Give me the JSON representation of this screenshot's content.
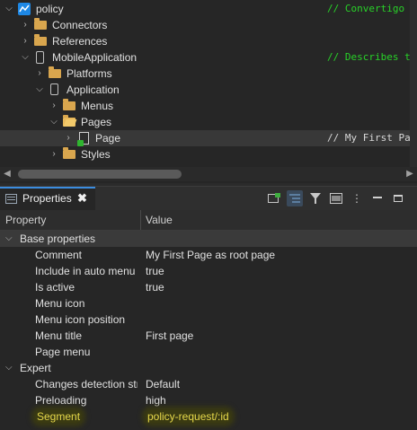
{
  "tree": {
    "rows": [
      {
        "label": "policy",
        "comment": "// Convertigo Mo"
      },
      {
        "label": "Connectors"
      },
      {
        "label": "References"
      },
      {
        "label": "MobileApplication",
        "comment": "// Describes the m"
      },
      {
        "label": "Platforms"
      },
      {
        "label": "Application"
      },
      {
        "label": "Menus"
      },
      {
        "label": "Pages"
      },
      {
        "label": "Page",
        "comment": "// My First Page a"
      },
      {
        "label": "Styles"
      }
    ]
  },
  "properties_view": {
    "tab_title": "Properties",
    "close_glyph": "✖",
    "columns": {
      "property": "Property",
      "value": "Value"
    },
    "categories": [
      {
        "name": "Base properties",
        "rows": [
          {
            "name": "Comment",
            "value": "My First Page as root page"
          },
          {
            "name": "Include in auto menu",
            "value": "true"
          },
          {
            "name": "Is active",
            "value": "true"
          },
          {
            "name": "Menu icon",
            "value": ""
          },
          {
            "name": "Menu icon position",
            "value": ""
          },
          {
            "name": "Menu title",
            "value": "First page"
          },
          {
            "name": "Page menu",
            "value": ""
          }
        ]
      },
      {
        "name": "Expert",
        "rows": [
          {
            "name": "Changes detection strategy",
            "value": "Default"
          },
          {
            "name": "Preloading",
            "value": "high"
          },
          {
            "name": "Segment",
            "value": "policy-request/:id"
          }
        ]
      }
    ],
    "toolbar_icons": [
      "new-item-icon",
      "filter-tree-icon",
      "funnel-icon",
      "layout-icon",
      "menu-kebab-icon",
      "minimize-icon",
      "maximize-icon"
    ]
  },
  "colors": {
    "accent": "#3b8de0",
    "comment_green": "#28d228",
    "highlight": "#e6d84a"
  }
}
